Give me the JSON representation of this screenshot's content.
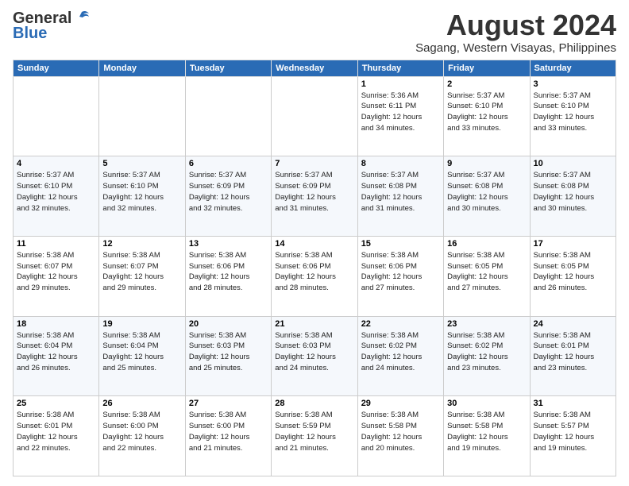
{
  "header": {
    "logo_general": "General",
    "logo_blue": "Blue",
    "month_title": "August 2024",
    "location": "Sagang, Western Visayas, Philippines"
  },
  "weekdays": [
    "Sunday",
    "Monday",
    "Tuesday",
    "Wednesday",
    "Thursday",
    "Friday",
    "Saturday"
  ],
  "weeks": [
    [
      {
        "day": "",
        "info": ""
      },
      {
        "day": "",
        "info": ""
      },
      {
        "day": "",
        "info": ""
      },
      {
        "day": "",
        "info": ""
      },
      {
        "day": "1",
        "info": "Sunrise: 5:36 AM\nSunset: 6:11 PM\nDaylight: 12 hours\nand 34 minutes."
      },
      {
        "day": "2",
        "info": "Sunrise: 5:37 AM\nSunset: 6:10 PM\nDaylight: 12 hours\nand 33 minutes."
      },
      {
        "day": "3",
        "info": "Sunrise: 5:37 AM\nSunset: 6:10 PM\nDaylight: 12 hours\nand 33 minutes."
      }
    ],
    [
      {
        "day": "4",
        "info": "Sunrise: 5:37 AM\nSunset: 6:10 PM\nDaylight: 12 hours\nand 32 minutes."
      },
      {
        "day": "5",
        "info": "Sunrise: 5:37 AM\nSunset: 6:10 PM\nDaylight: 12 hours\nand 32 minutes."
      },
      {
        "day": "6",
        "info": "Sunrise: 5:37 AM\nSunset: 6:09 PM\nDaylight: 12 hours\nand 32 minutes."
      },
      {
        "day": "7",
        "info": "Sunrise: 5:37 AM\nSunset: 6:09 PM\nDaylight: 12 hours\nand 31 minutes."
      },
      {
        "day": "8",
        "info": "Sunrise: 5:37 AM\nSunset: 6:08 PM\nDaylight: 12 hours\nand 31 minutes."
      },
      {
        "day": "9",
        "info": "Sunrise: 5:37 AM\nSunset: 6:08 PM\nDaylight: 12 hours\nand 30 minutes."
      },
      {
        "day": "10",
        "info": "Sunrise: 5:37 AM\nSunset: 6:08 PM\nDaylight: 12 hours\nand 30 minutes."
      }
    ],
    [
      {
        "day": "11",
        "info": "Sunrise: 5:38 AM\nSunset: 6:07 PM\nDaylight: 12 hours\nand 29 minutes."
      },
      {
        "day": "12",
        "info": "Sunrise: 5:38 AM\nSunset: 6:07 PM\nDaylight: 12 hours\nand 29 minutes."
      },
      {
        "day": "13",
        "info": "Sunrise: 5:38 AM\nSunset: 6:06 PM\nDaylight: 12 hours\nand 28 minutes."
      },
      {
        "day": "14",
        "info": "Sunrise: 5:38 AM\nSunset: 6:06 PM\nDaylight: 12 hours\nand 28 minutes."
      },
      {
        "day": "15",
        "info": "Sunrise: 5:38 AM\nSunset: 6:06 PM\nDaylight: 12 hours\nand 27 minutes."
      },
      {
        "day": "16",
        "info": "Sunrise: 5:38 AM\nSunset: 6:05 PM\nDaylight: 12 hours\nand 27 minutes."
      },
      {
        "day": "17",
        "info": "Sunrise: 5:38 AM\nSunset: 6:05 PM\nDaylight: 12 hours\nand 26 minutes."
      }
    ],
    [
      {
        "day": "18",
        "info": "Sunrise: 5:38 AM\nSunset: 6:04 PM\nDaylight: 12 hours\nand 26 minutes."
      },
      {
        "day": "19",
        "info": "Sunrise: 5:38 AM\nSunset: 6:04 PM\nDaylight: 12 hours\nand 25 minutes."
      },
      {
        "day": "20",
        "info": "Sunrise: 5:38 AM\nSunset: 6:03 PM\nDaylight: 12 hours\nand 25 minutes."
      },
      {
        "day": "21",
        "info": "Sunrise: 5:38 AM\nSunset: 6:03 PM\nDaylight: 12 hours\nand 24 minutes."
      },
      {
        "day": "22",
        "info": "Sunrise: 5:38 AM\nSunset: 6:02 PM\nDaylight: 12 hours\nand 24 minutes."
      },
      {
        "day": "23",
        "info": "Sunrise: 5:38 AM\nSunset: 6:02 PM\nDaylight: 12 hours\nand 23 minutes."
      },
      {
        "day": "24",
        "info": "Sunrise: 5:38 AM\nSunset: 6:01 PM\nDaylight: 12 hours\nand 23 minutes."
      }
    ],
    [
      {
        "day": "25",
        "info": "Sunrise: 5:38 AM\nSunset: 6:01 PM\nDaylight: 12 hours\nand 22 minutes."
      },
      {
        "day": "26",
        "info": "Sunrise: 5:38 AM\nSunset: 6:00 PM\nDaylight: 12 hours\nand 22 minutes."
      },
      {
        "day": "27",
        "info": "Sunrise: 5:38 AM\nSunset: 6:00 PM\nDaylight: 12 hours\nand 21 minutes."
      },
      {
        "day": "28",
        "info": "Sunrise: 5:38 AM\nSunset: 5:59 PM\nDaylight: 12 hours\nand 21 minutes."
      },
      {
        "day": "29",
        "info": "Sunrise: 5:38 AM\nSunset: 5:58 PM\nDaylight: 12 hours\nand 20 minutes."
      },
      {
        "day": "30",
        "info": "Sunrise: 5:38 AM\nSunset: 5:58 PM\nDaylight: 12 hours\nand 19 minutes."
      },
      {
        "day": "31",
        "info": "Sunrise: 5:38 AM\nSunset: 5:57 PM\nDaylight: 12 hours\nand 19 minutes."
      }
    ]
  ]
}
